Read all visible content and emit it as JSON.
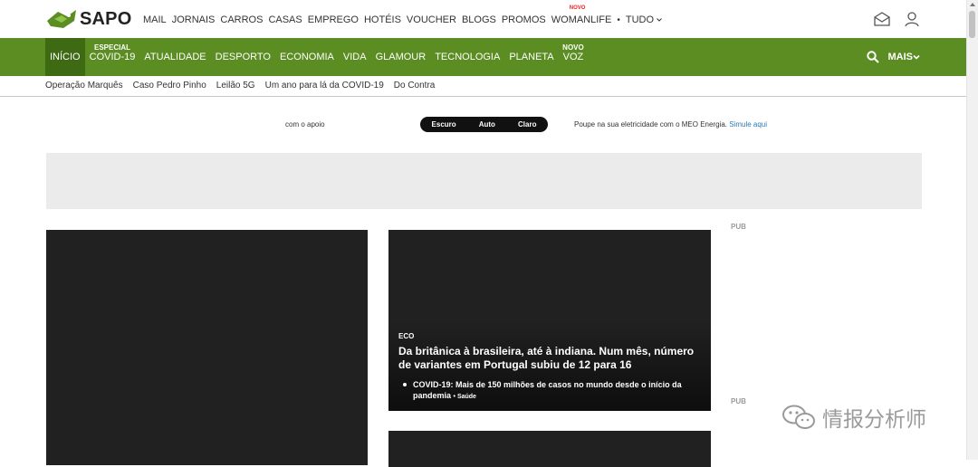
{
  "brand": {
    "name": "SAPO",
    "logo_color": "#5b8d22"
  },
  "top_links": [
    "MAIL",
    "JORNAIS",
    "CARROS",
    "CASAS",
    "EMPREGO",
    "HOTÉIS",
    "VOUCHER",
    "BLOGS",
    "PROMOS",
    "WOMANLIFE"
  ],
  "womanlife_tag": "NOVO",
  "tudo_label": "TUDO",
  "nav": [
    {
      "label": "INÍCIO",
      "sup": "",
      "active": true
    },
    {
      "label": "COVID-19",
      "sup": "ESPECIAL",
      "active": false
    },
    {
      "label": "ATUALIDADE",
      "sup": "",
      "active": false
    },
    {
      "label": "DESPORTO",
      "sup": "",
      "active": false
    },
    {
      "label": "ECONOMIA",
      "sup": "",
      "active": false
    },
    {
      "label": "VIDA",
      "sup": "",
      "active": false
    },
    {
      "label": "GLAMOUR",
      "sup": "",
      "active": false
    },
    {
      "label": "TECNOLOGIA",
      "sup": "",
      "active": false
    },
    {
      "label": "PLANETA",
      "sup": "",
      "active": false
    },
    {
      "label": "VOZ",
      "sup": "NOVO",
      "active": false
    }
  ],
  "mais_label": "MAIS",
  "sub_links": [
    "Operação Marquês",
    "Caso Pedro Pinho",
    "Leilão 5G",
    "Um ano para lá da COVID-19",
    "Do Contra"
  ],
  "theme": {
    "apoio_label": "com o apoio",
    "options": [
      "Escuro",
      "Auto",
      "Claro"
    ],
    "promo_text": "Poupe na sua eletricidade com o MEO Energia.",
    "promo_link": "Simule aqui"
  },
  "pub_label": "PUB",
  "article": {
    "category": "ECO",
    "title": "Da britânica à brasileira, até à indiana. Num mês, número de variantes em Portugal subiu de 12 para 16",
    "bullet_text": "COVID-19: Mais de 150 milhões de casos no mundo desde o início da pandemia",
    "bullet_tag": "Saúde"
  },
  "watermark_text": "情报分析师"
}
